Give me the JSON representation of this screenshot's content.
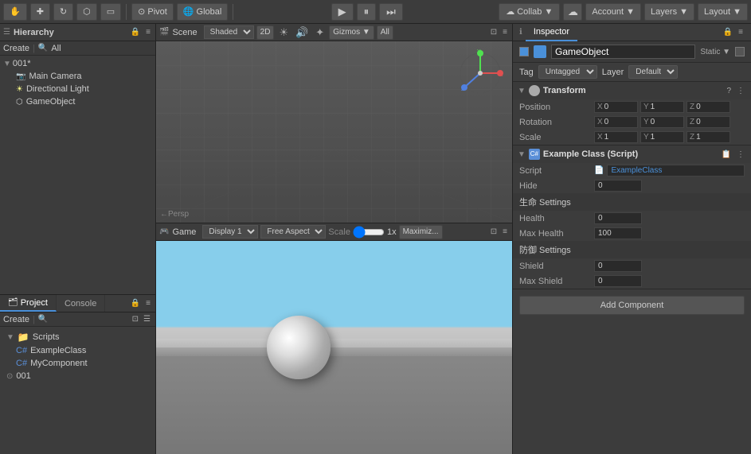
{
  "toolbar": {
    "pivot_label": "Pivot",
    "global_label": "Global",
    "play_icon": "▶",
    "pause_icon": "⏸",
    "step_icon": "⏭",
    "collab_label": "Collab ▼",
    "account_label": "Account ▼",
    "layers_label": "Layers ▼",
    "layout_label": "Layout ▼"
  },
  "hierarchy": {
    "title": "Hierarchy",
    "create_label": "Create",
    "all_label": "All",
    "root_item": "001*",
    "items": [
      {
        "label": "Main Camera",
        "type": "camera"
      },
      {
        "label": "Directional Light",
        "type": "light"
      },
      {
        "label": "GameObject",
        "type": "gameobject",
        "selected": true
      }
    ]
  },
  "scene": {
    "title": "Scene",
    "shaded_label": "Shaded",
    "mode_2d": "2D",
    "gizmos_label": "Gizmos ▼",
    "all_label": "All",
    "persp_label": "←Persp"
  },
  "game": {
    "title": "Game",
    "display_label": "Display 1",
    "aspect_label": "Free Aspect",
    "scale_label": "Scale",
    "scale_value": "1x",
    "maximize_label": "Maximiz..."
  },
  "project": {
    "title": "Project",
    "console_label": "Console",
    "create_label": "Create",
    "folders": [
      {
        "label": "Scripts",
        "items": [
          "ExampleClass",
          "MyComponent"
        ]
      }
    ],
    "scenes": [
      "001"
    ]
  },
  "inspector": {
    "title": "Inspector",
    "gameobject_name": "GameObject",
    "static_label": "Static ▼",
    "tag_label": "Tag",
    "tag_value": "Untagged",
    "layer_label": "Layer",
    "layer_value": "Default",
    "transform": {
      "title": "Transform",
      "position_label": "Position",
      "rotation_label": "Rotation",
      "scale_label": "Scale",
      "position": {
        "x": "0",
        "y": "1",
        "z": "0"
      },
      "rotation": {
        "x": "0",
        "y": "0",
        "z": "0"
      },
      "scale": {
        "x": "1",
        "y": "1",
        "z": "1"
      }
    },
    "script_component": {
      "title": "Example Class (Script)",
      "script_label": "Script",
      "script_value": "ExampleClass",
      "hide_label": "Hide",
      "hide_value": "0",
      "life_settings_label": "生命 Settings",
      "health_label": "Health",
      "health_value": "0",
      "max_health_label": "Max Health",
      "max_health_value": "100",
      "shield_settings_label": "防御 Settings",
      "shield_label": "Shield",
      "shield_value": "0",
      "max_shield_label": "Max Shield",
      "max_shield_value": "0"
    },
    "add_component_label": "Add Component"
  }
}
